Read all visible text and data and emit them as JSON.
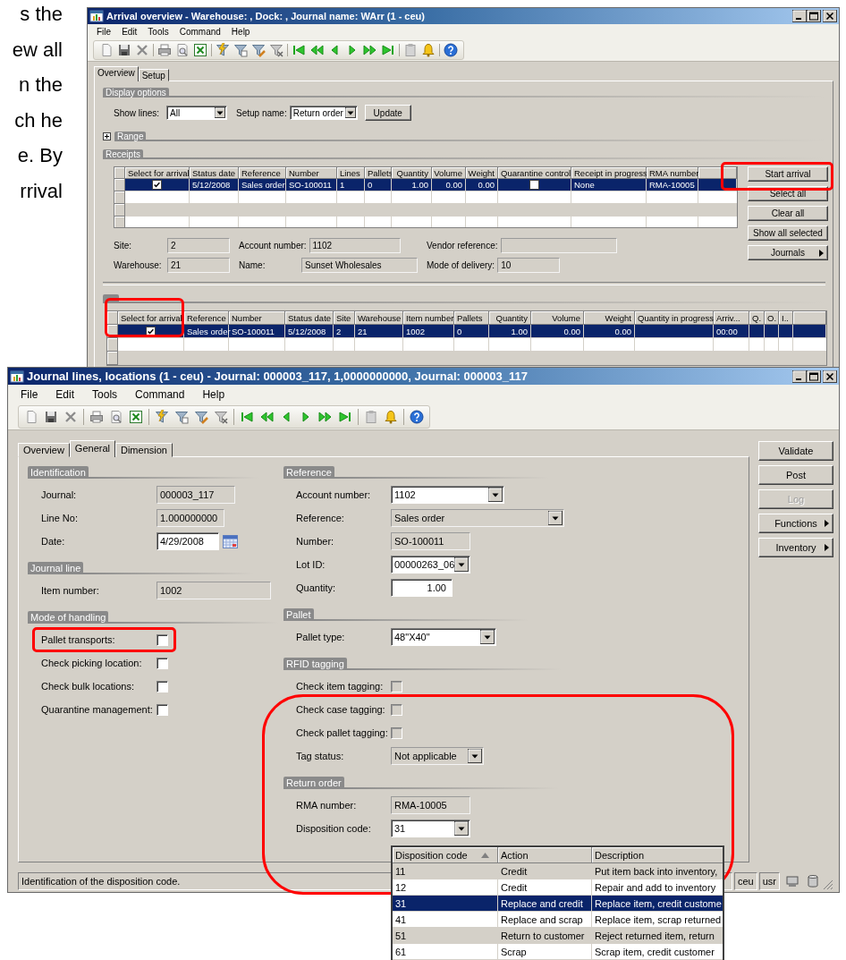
{
  "document_text": [
    "s the",
    "ew all",
    "n the",
    "ch he",
    "e.  By",
    "rrival"
  ],
  "arrival_window": {
    "title": "Arrival overview - Warehouse: , Dock: , Journal name: WArr (1 - ceu)",
    "menu": [
      "File",
      "Edit",
      "Tools",
      "Command",
      "Help"
    ],
    "tabs": [
      {
        "label": "Overview",
        "selected": true
      },
      {
        "label": "Setup",
        "selected": false
      }
    ],
    "display_options": {
      "header": "Display options",
      "show_lines": {
        "label": "Show lines:",
        "kind": "combo",
        "value": "All",
        "editable": true
      },
      "setup_name": {
        "label": "Setup name:",
        "kind": "combo",
        "value": "Return order",
        "editable": true
      },
      "update_button": "Update"
    },
    "range": {
      "label": "Range",
      "expanded": false
    },
    "receipts": {
      "header": "Receipts",
      "columns": [
        "Select for arrival",
        "Status date",
        "Reference",
        "Number",
        "Lines",
        "Pallets",
        "Quantity",
        "Volume",
        "Weight",
        "Quarantine control",
        "Receipt in progress",
        "RMA number"
      ],
      "rows": [
        {
          "selected": true,
          "cells": [
            {
              "checked": true
            },
            "5/12/2008",
            "Sales order",
            "SO-100011",
            "1",
            "0",
            "1.00",
            "0.00",
            "0.00",
            {
              "checked": false
            },
            "None",
            "RMA-10005"
          ]
        }
      ]
    },
    "buttons": [
      {
        "label": "Start arrival",
        "kind": "push"
      },
      {
        "label": "Select all",
        "kind": "push"
      },
      {
        "label": "Clear all",
        "kind": "push"
      },
      {
        "label": "Show all selected",
        "kind": "push"
      },
      {
        "label": "Journals",
        "kind": "menu"
      }
    ],
    "details": [
      {
        "label": "Site:",
        "kind": "text",
        "value": "2",
        "editable": false
      },
      {
        "label": "Account number:",
        "kind": "text",
        "value": "1102",
        "editable": false
      },
      {
        "label": "Vendor reference:",
        "kind": "text",
        "editable": false
      },
      {
        "label": "Warehouse:",
        "kind": "text",
        "value": "21",
        "editable": false
      },
      {
        "label": "Name:",
        "kind": "text",
        "value": "Sunset Wholesales",
        "editable": false
      },
      {
        "label": "Mode of delivery:",
        "kind": "text",
        "value": "10",
        "editable": false
      }
    ],
    "lines": {
      "columns": [
        "Select for arrival",
        "Reference",
        "Number",
        "Status date",
        "Site",
        "Warehouse",
        "Item number",
        "Pallets",
        "Quantity",
        "Volume",
        "Weight",
        "Quantity in progress",
        "Arriv...",
        "Q.",
        "O.",
        "I.."
      ],
      "rows": [
        {
          "selected": true,
          "cells": [
            {
              "checked": true
            },
            "Sales order",
            "SO-100011",
            "5/12/2008",
            "2",
            "21",
            "1002",
            "0",
            "1.00",
            "0.00",
            "0.00",
            null,
            "00:00"
          ]
        }
      ]
    }
  },
  "journal_window": {
    "title": "Journal lines, locations (1 - ceu) - Journal: 000003_117, 1,0000000000, Journal: 000003_117",
    "menu": [
      "File",
      "Edit",
      "Tools",
      "Command",
      "Help"
    ],
    "tabs": [
      {
        "label": "Overview",
        "selected": false
      },
      {
        "label": "General",
        "selected": true
      },
      {
        "label": "Dimension",
        "selected": false
      }
    ],
    "groups_left": [
      {
        "header": "Identification",
        "fields": [
          {
            "label": "Journal:",
            "kind": "text",
            "value": "000003_117",
            "editable": false
          },
          {
            "label": "Line No:",
            "kind": "text",
            "value": "1.000000000",
            "editable": false
          },
          {
            "label": "Date:",
            "kind": "date",
            "value": "4/29/2008",
            "editable": true
          }
        ]
      },
      {
        "header": "Journal line",
        "fields": [
          {
            "label": "Item number:",
            "kind": "text",
            "value": "1002",
            "editable": false
          }
        ]
      },
      {
        "header": "Mode of handling",
        "fields": [
          {
            "label": "Pallet transports:",
            "kind": "checkbox",
            "checked": false,
            "disabled": false
          },
          {
            "label": "Check picking location:",
            "kind": "checkbox",
            "checked": false,
            "disabled": false
          },
          {
            "label": "Check bulk locations:",
            "kind": "checkbox",
            "checked": false,
            "disabled": false
          },
          {
            "label": "Quarantine management:",
            "kind": "checkbox",
            "checked": false,
            "disabled": false
          }
        ]
      }
    ],
    "groups_right": [
      {
        "header": "Reference",
        "fields": [
          {
            "label": "Account number:",
            "kind": "combo",
            "value": "1102",
            "editable": true
          },
          {
            "label": "Reference:",
            "kind": "combo",
            "value": "Sales order",
            "editable": false
          },
          {
            "label": "Number:",
            "kind": "text",
            "value": "SO-100011",
            "editable": false
          },
          {
            "label": "Lot ID:",
            "kind": "combo",
            "value": "00000263_06",
            "editable": true
          },
          {
            "label": "Quantity:",
            "kind": "number",
            "value": "1.00",
            "editable": true
          }
        ]
      },
      {
        "header": "Pallet",
        "fields": [
          {
            "label": "Pallet type:",
            "kind": "combo",
            "value": "48\"X40\"",
            "editable": true
          }
        ]
      },
      {
        "header": "RFID tagging",
        "fields": [
          {
            "label": "Check item tagging:",
            "kind": "checkbox",
            "checked": false,
            "disabled": true
          },
          {
            "label": "Check case tagging:",
            "kind": "checkbox",
            "checked": false,
            "disabled": true
          },
          {
            "label": "Check pallet tagging:",
            "kind": "checkbox",
            "checked": false,
            "disabled": true
          },
          {
            "label": "Tag status:",
            "kind": "combo",
            "value": "Not applicable",
            "editable": false
          }
        ]
      },
      {
        "header": "Return order",
        "fields": [
          {
            "label": "RMA number:",
            "kind": "text",
            "value": "RMA-10005",
            "editable": false
          },
          {
            "label": "Disposition code:",
            "kind": "combo",
            "value": "31",
            "editable": true
          }
        ]
      }
    ],
    "buttons": [
      {
        "label": "Validate",
        "kind": "push",
        "disabled": false
      },
      {
        "label": "Post",
        "kind": "push",
        "disabled": false
      },
      {
        "label": "Log",
        "kind": "push",
        "disabled": true
      },
      {
        "label": "Functions",
        "kind": "menu",
        "disabled": false
      },
      {
        "label": "Inventory",
        "kind": "menu",
        "disabled": false
      }
    ],
    "status_bar": {
      "message": "Identification of the disposition code.",
      "company": "ceu",
      "layer": "usr"
    }
  },
  "disposition_lookup": {
    "columns": [
      {
        "label": "Disposition code",
        "sorted": true
      },
      {
        "label": "Action",
        "sorted": false
      },
      {
        "label": "Description",
        "sorted": false
      }
    ],
    "rows": [
      {
        "selected": false,
        "cells": [
          "11",
          "Credit",
          "Put item back into inventory,"
        ]
      },
      {
        "selected": false,
        "cells": [
          "12",
          "Credit",
          "Repair and add to inventory"
        ]
      },
      {
        "selected": true,
        "cells": [
          "31",
          "Replace and credit",
          "Replace item, credit custome"
        ]
      },
      {
        "selected": false,
        "cells": [
          "41",
          "Replace and scrap",
          "Replace item, scrap returned"
        ]
      },
      {
        "selected": false,
        "cells": [
          "51",
          "Return to customer",
          "Reject returned item, return"
        ]
      },
      {
        "selected": false,
        "cells": [
          "61",
          "Scrap",
          "Scrap item, credit customer"
        ]
      }
    ]
  }
}
